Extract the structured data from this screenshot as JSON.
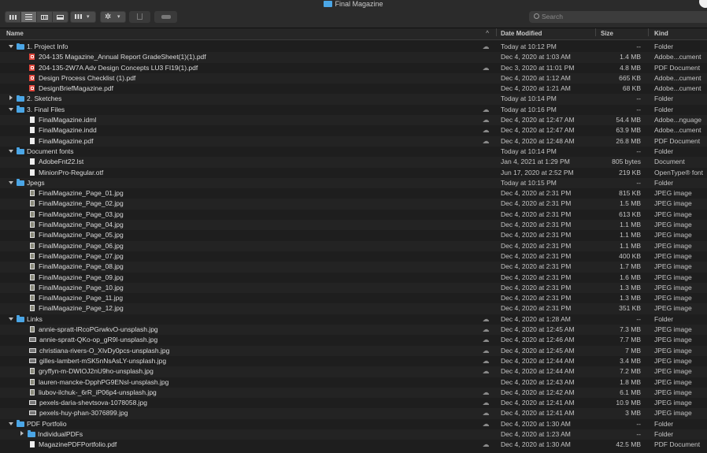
{
  "window": {
    "title": "Final Magazine"
  },
  "search": {
    "placeholder": "Search"
  },
  "columns": {
    "name": "Name",
    "date": "Date Modified",
    "size": "Size",
    "kind": "Kind"
  },
  "colors": {
    "folder": "#4ba6e6",
    "pdf": "#e0473c",
    "background": "#1e1e1e"
  },
  "rows": [
    {
      "depth": 0,
      "type": "folder",
      "expand": "down",
      "name": "1. Project Info",
      "cloud": true,
      "date": "Today at 10:12 PM",
      "size": "--",
      "kind": "Folder"
    },
    {
      "depth": 1,
      "type": "pdf",
      "name": "204-135 Magazine_Annual Report GradeSheet(1)(1).pdf",
      "cloud": false,
      "date": "Dec 4, 2020 at 1:03 AM",
      "size": "1.4 MB",
      "kind": "Adobe...cument"
    },
    {
      "depth": 1,
      "type": "pdf",
      "name": "204-135-2W7A Adv Design Concepts LU3 FI19(1).pdf",
      "cloud": true,
      "date": "Dec 3, 2020 at 11:01 PM",
      "size": "4.8 MB",
      "kind": "PDF Document"
    },
    {
      "depth": 1,
      "type": "pdf",
      "name": "Design Process Checklist (1).pdf",
      "cloud": false,
      "date": "Dec 4, 2020 at 1:12 AM",
      "size": "665 KB",
      "kind": "Adobe...cument"
    },
    {
      "depth": 1,
      "type": "pdf",
      "name": "DesignBriefMagazine.pdf",
      "cloud": false,
      "date": "Dec 4, 2020 at 1:21 AM",
      "size": "68 KB",
      "kind": "Adobe...cument"
    },
    {
      "depth": 0,
      "type": "folder",
      "expand": "right",
      "name": "2. Sketches",
      "cloud": false,
      "date": "Today at 10:14 PM",
      "size": "--",
      "kind": "Folder"
    },
    {
      "depth": 0,
      "type": "folder",
      "expand": "down",
      "name": "3. Final Files",
      "cloud": true,
      "date": "Today at 10:16 PM",
      "size": "--",
      "kind": "Folder"
    },
    {
      "depth": 1,
      "type": "doc",
      "name": "FinalMagazine.idml",
      "cloud": true,
      "date": "Dec 4, 2020 at 12:47 AM",
      "size": "54.4 MB",
      "kind": "Adobe...nguage"
    },
    {
      "depth": 1,
      "type": "doc",
      "name": "FinalMagazine.indd",
      "cloud": true,
      "date": "Dec 4, 2020 at 12:47 AM",
      "size": "63.9 MB",
      "kind": "Adobe...cument"
    },
    {
      "depth": 1,
      "type": "doc",
      "name": "FinalMagazine.pdf",
      "cloud": true,
      "date": "Dec 4, 2020 at 12:48 AM",
      "size": "26.8 MB",
      "kind": "PDF Document"
    },
    {
      "depth": 0,
      "type": "folder",
      "expand": "down",
      "name": "Document fonts",
      "cloud": false,
      "date": "Today at 10:14 PM",
      "size": "--",
      "kind": "Folder"
    },
    {
      "depth": 1,
      "type": "doc",
      "name": "AdobeFnt22.lst",
      "cloud": false,
      "date": "Jan 4, 2021 at 1:29 PM",
      "size": "805 bytes",
      "kind": "Document"
    },
    {
      "depth": 1,
      "type": "doc",
      "name": "MinionPro-Regular.otf",
      "cloud": false,
      "date": "Jun 17, 2020 at 2:52 PM",
      "size": "219 KB",
      "kind": "OpenType® font"
    },
    {
      "depth": 0,
      "type": "folder",
      "expand": "down",
      "name": "Jpegs",
      "cloud": false,
      "date": "Today at 10:15 PM",
      "size": "--",
      "kind": "Folder"
    },
    {
      "depth": 1,
      "type": "img",
      "name": "FinalMagazine_Page_01.jpg",
      "cloud": false,
      "date": "Dec 4, 2020 at 2:31 PM",
      "size": "815 KB",
      "kind": "JPEG image"
    },
    {
      "depth": 1,
      "type": "img",
      "name": "FinalMagazine_Page_02.jpg",
      "cloud": false,
      "date": "Dec 4, 2020 at 2:31 PM",
      "size": "1.5 MB",
      "kind": "JPEG image"
    },
    {
      "depth": 1,
      "type": "img",
      "name": "FinalMagazine_Page_03.jpg",
      "cloud": false,
      "date": "Dec 4, 2020 at 2:31 PM",
      "size": "613 KB",
      "kind": "JPEG image"
    },
    {
      "depth": 1,
      "type": "img",
      "name": "FinalMagazine_Page_04.jpg",
      "cloud": false,
      "date": "Dec 4, 2020 at 2:31 PM",
      "size": "1.1 MB",
      "kind": "JPEG image"
    },
    {
      "depth": 1,
      "type": "img",
      "name": "FinalMagazine_Page_05.jpg",
      "cloud": false,
      "date": "Dec 4, 2020 at 2:31 PM",
      "size": "1.1 MB",
      "kind": "JPEG image"
    },
    {
      "depth": 1,
      "type": "img",
      "name": "FinalMagazine_Page_06.jpg",
      "cloud": false,
      "date": "Dec 4, 2020 at 2:31 PM",
      "size": "1.1 MB",
      "kind": "JPEG image"
    },
    {
      "depth": 1,
      "type": "img",
      "name": "FinalMagazine_Page_07.jpg",
      "cloud": false,
      "date": "Dec 4, 2020 at 2:31 PM",
      "size": "400 KB",
      "kind": "JPEG image"
    },
    {
      "depth": 1,
      "type": "img",
      "name": "FinalMagazine_Page_08.jpg",
      "cloud": false,
      "date": "Dec 4, 2020 at 2:31 PM",
      "size": "1.7 MB",
      "kind": "JPEG image"
    },
    {
      "depth": 1,
      "type": "img",
      "name": "FinalMagazine_Page_09.jpg",
      "cloud": false,
      "date": "Dec 4, 2020 at 2:31 PM",
      "size": "1.6 MB",
      "kind": "JPEG image"
    },
    {
      "depth": 1,
      "type": "img",
      "name": "FinalMagazine_Page_10.jpg",
      "cloud": false,
      "date": "Dec 4, 2020 at 2:31 PM",
      "size": "1.3 MB",
      "kind": "JPEG image"
    },
    {
      "depth": 1,
      "type": "img",
      "name": "FinalMagazine_Page_11.jpg",
      "cloud": false,
      "date": "Dec 4, 2020 at 2:31 PM",
      "size": "1.3 MB",
      "kind": "JPEG image"
    },
    {
      "depth": 1,
      "type": "img",
      "name": "FinalMagazine_Page_12.jpg",
      "cloud": false,
      "date": "Dec 4, 2020 at 2:31 PM",
      "size": "351 KB",
      "kind": "JPEG image"
    },
    {
      "depth": 0,
      "type": "folder",
      "expand": "down",
      "name": "Links",
      "cloud": true,
      "date": "Dec 4, 2020 at 1:28 AM",
      "size": "--",
      "kind": "Folder"
    },
    {
      "depth": 1,
      "type": "img",
      "name": "annie-spratt-lRcoPGrwkvO-unsplash.jpg",
      "cloud": true,
      "date": "Dec 4, 2020 at 12:45 AM",
      "size": "7.3 MB",
      "kind": "JPEG image"
    },
    {
      "depth": 1,
      "type": "imgw",
      "name": "annie-spratt-QKo-op_gR9I-unsplash.jpg",
      "cloud": true,
      "date": "Dec 4, 2020 at 12:46 AM",
      "size": "7.7 MB",
      "kind": "JPEG image"
    },
    {
      "depth": 1,
      "type": "imgw",
      "name": "christiana-rivers-O_XIvDy0pcs-unsplash.jpg",
      "cloud": true,
      "date": "Dec 4, 2020 at 12:45 AM",
      "size": "7 MB",
      "kind": "JPEG image"
    },
    {
      "depth": 1,
      "type": "imgw",
      "name": "gilles-lambert-mSK5nNsAsLY-unsplash.jpg",
      "cloud": true,
      "date": "Dec 4, 2020 at 12:44 AM",
      "size": "3.4 MB",
      "kind": "JPEG image"
    },
    {
      "depth": 1,
      "type": "img",
      "name": "gryffyn-m-DWIOJ2nU9ho-unsplash.jpg",
      "cloud": true,
      "date": "Dec 4, 2020 at 12:44 AM",
      "size": "7.2 MB",
      "kind": "JPEG image"
    },
    {
      "depth": 1,
      "type": "img",
      "name": "lauren-mancke-DpphPG9ENsI-unsplash.jpg",
      "cloud": false,
      "date": "Dec 4, 2020 at 12:43 AM",
      "size": "1.8 MB",
      "kind": "JPEG image"
    },
    {
      "depth": 1,
      "type": "img",
      "name": "liubov-ilchuk-_6rR_iP06p4-unsplash.jpg",
      "cloud": true,
      "date": "Dec 4, 2020 at 12:42 AM",
      "size": "6.1 MB",
      "kind": "JPEG image"
    },
    {
      "depth": 1,
      "type": "imgw",
      "name": "pexels-daria-shevtsova-1078058.jpg",
      "cloud": true,
      "date": "Dec 4, 2020 at 12:41 AM",
      "size": "10.9 MB",
      "kind": "JPEG image"
    },
    {
      "depth": 1,
      "type": "imgw",
      "name": "pexels-huy-phan-3076899.jpg",
      "cloud": true,
      "date": "Dec 4, 2020 at 12:41 AM",
      "size": "3 MB",
      "kind": "JPEG image"
    },
    {
      "depth": 0,
      "type": "folder",
      "expand": "down",
      "name": "PDF Portfolio",
      "cloud": true,
      "date": "Dec 4, 2020 at 1:30 AM",
      "size": "--",
      "kind": "Folder"
    },
    {
      "depth": 1,
      "type": "folder",
      "expand": "right",
      "name": "IndividualPDFs",
      "cloud": false,
      "date": "Dec 4, 2020 at 1:23 AM",
      "size": "--",
      "kind": "Folder"
    },
    {
      "depth": 1,
      "type": "doc",
      "name": "MagazinePDFPortfolio.pdf",
      "cloud": true,
      "date": "Dec 4, 2020 at 1:30 AM",
      "size": "42.5 MB",
      "kind": "PDF Document"
    }
  ]
}
